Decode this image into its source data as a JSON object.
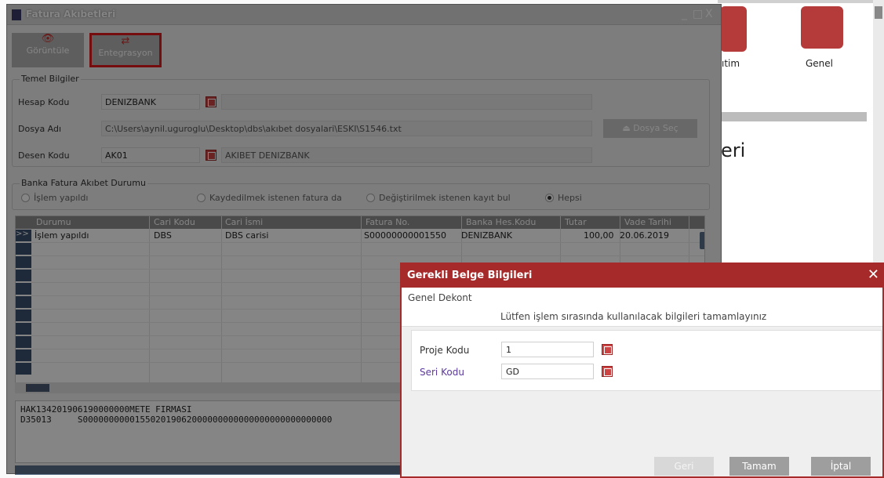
{
  "window": {
    "title": "Fatura Akıbetleri",
    "controls": [
      "_",
      "□",
      "X"
    ]
  },
  "toolbar": {
    "goruntule": "Görüntüle",
    "entegrasyon": "Entegrasyon"
  },
  "temel": {
    "legend": "Temel Bilgiler",
    "hesap_label": "Hesap Kodu",
    "hesap_value": "DENIZBANK",
    "dosya_label": "Dosya Adı",
    "dosya_value": "C:\\Users\\aynil.uguroglu\\Desktop\\dbs\\akıbet dosyalari\\ESKI\\S1546.txt",
    "dosya_button": "Dosya Seç",
    "desen_label": "Desen Kodu",
    "desen_value": "AK01",
    "desen_desc": "AKIBET DENIZBANK"
  },
  "durum": {
    "legend": "Banka Fatura Akıbet Durumu",
    "options": [
      "İşlem yapıldı",
      "Kaydedilmek istenen fatura da",
      "Değiştirilmek istenen kayıt bul",
      "Hepsi"
    ],
    "selected": "Hepsi"
  },
  "grid": {
    "columns": [
      "Durumu",
      "Cari Kodu",
      "Cari İsmi",
      "Fatura No.",
      "Banka Hes.Kodu",
      "Tutar",
      "Vade Tarihi"
    ],
    "rows": [
      {
        "indicator": ">>",
        "durumu": "İşlem yapıldı",
        "cari_kodu": "DBS",
        "cari_ismi": "DBS carisi",
        "fatura_no": "S00000000001550",
        "banka_hes_kodu": "DENIZBANK",
        "tutar": "100,00",
        "vade_tarihi": "20.06.2019"
      }
    ]
  },
  "log": {
    "line1": "HAK134201906190000000METE FIRMASI",
    "line2": "D35013     S000000000015502019062000000000000000000000000000"
  },
  "background": {
    "label_left": "ıtim",
    "label_right": "Genel",
    "heading_fragment": "eri"
  },
  "dialog": {
    "title": "Gerekli Belge Bilgileri",
    "subtitle": "Genel Dekont",
    "description": "Lütfen işlem sırasında kullanılacak bilgileri tamamlayınız",
    "proje_label": "Proje Kodu",
    "proje_value": "1",
    "seri_label": "Seri Kodu",
    "seri_value": "GD",
    "buttons": {
      "geri": "Geri",
      "tamam": "Tamam",
      "iptal": "İptal"
    },
    "accent_color": "#a62a2a"
  }
}
